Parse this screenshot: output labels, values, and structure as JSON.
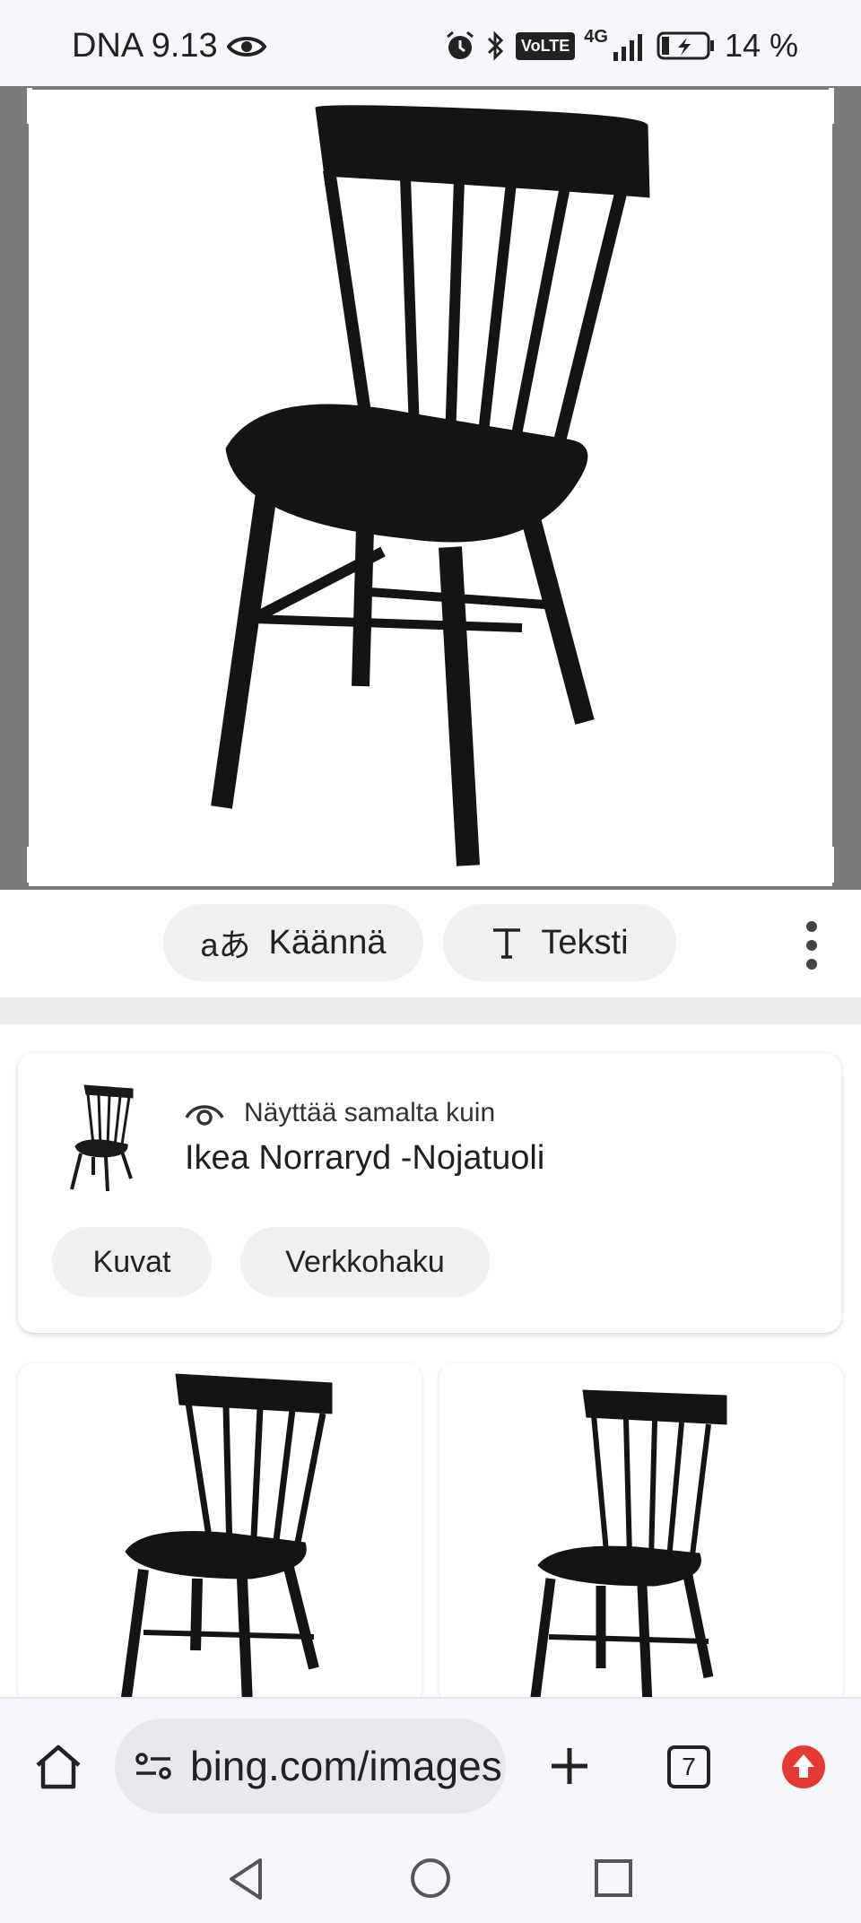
{
  "status_bar": {
    "carrier_time": "DNA 9.13",
    "network": "4G",
    "volte": "VoLTE",
    "battery": "14 %"
  },
  "actions": {
    "translate_label": "Käännä",
    "text_label": "Teksti"
  },
  "result_card": {
    "caption": "Näyttää samalta kuin",
    "title": "Ikea Norraryd -Nojatuoli",
    "pills": [
      "Kuvat",
      "Verkkohaku"
    ]
  },
  "browser": {
    "url": "bing.com/images",
    "tab_count": "7"
  },
  "icons": {
    "eye": "eye-icon",
    "alarm": "alarm-icon",
    "bluetooth": "bluetooth-icon",
    "home": "home-icon",
    "plus": "plus-icon",
    "tabs": "tabs-icon",
    "upload": "upload-icon",
    "more": "more-vert-icon"
  },
  "colors": {
    "accent_red": "#e53935",
    "chip_bg": "#f0f0f3",
    "viewer_bg": "#7a7a7a"
  }
}
